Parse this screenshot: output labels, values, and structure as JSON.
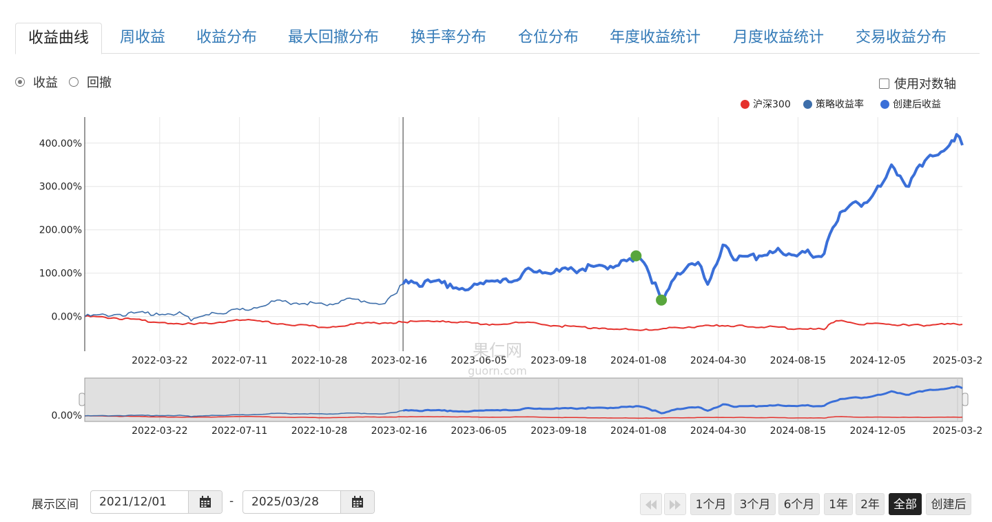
{
  "tabs": [
    "收益曲线",
    "周收益",
    "收益分布",
    "最大回撤分布",
    "换手率分布",
    "仓位分布",
    "年度收益统计",
    "月度收益统计",
    "交易收益分布"
  ],
  "active_tab": 0,
  "mode_options": [
    "收益",
    "回撤"
  ],
  "mode_selected": 0,
  "log_axis_label": "使用对数轴",
  "watermark": {
    "main": "果仁网",
    "sub": "guorn.com"
  },
  "range": {
    "label": "展示区间",
    "start": "2021/12/01",
    "end": "2025/03/28",
    "separator": "-"
  },
  "zoom_buttons": [
    "1个月",
    "3个月",
    "6个月",
    "1年",
    "2年",
    "全部",
    "创建后"
  ],
  "zoom_active": 5,
  "chart_data": {
    "type": "line",
    "ylabel": "",
    "yticks": [
      "0.00%",
      "100.00%",
      "200.00%",
      "300.00%",
      "400.00%"
    ],
    "ylim": [
      -80,
      460
    ],
    "xticks": [
      "2022-03-22",
      "2022-07-11",
      "2022-10-28",
      "2023-02-16",
      "2023-06-05",
      "2023-09-18",
      "2024-01-08",
      "2024-04-30",
      "2024-08-15",
      "2024-12-05",
      "2025-03-2"
    ],
    "navigator_ytick": "0.00%",
    "grid": true,
    "legend_position": "top-right",
    "creation_date": "2023-02-14",
    "series": [
      {
        "name": "沪深300",
        "color": "#e5322d",
        "x": [
          "2021-12-01",
          "2022-01-10",
          "2022-03-22",
          "2022-05-01",
          "2022-07-11",
          "2022-09-01",
          "2022-10-28",
          "2022-12-20",
          "2023-02-16",
          "2023-04-10",
          "2023-06-05",
          "2023-08-01",
          "2023-09-18",
          "2023-11-20",
          "2024-01-08",
          "2024-02-05",
          "2024-03-15",
          "2024-04-30",
          "2024-05-20",
          "2024-07-01",
          "2024-08-15",
          "2024-09-18",
          "2024-09-24",
          "2024-10-08",
          "2024-11-01",
          "2024-12-05",
          "2025-01-13",
          "2025-02-15",
          "2025-03-28"
        ],
        "y": [
          0,
          -3,
          -14,
          -18,
          -8,
          -17,
          -25,
          -16,
          -13,
          -10,
          -18,
          -14,
          -22,
          -27,
          -32,
          -29,
          -24,
          -21,
          -21,
          -24,
          -28,
          -30,
          -19,
          -10,
          -17,
          -16,
          -21,
          -19,
          -18
        ]
      },
      {
        "name": "策略收益率",
        "color": "#3d6eaa",
        "x": [
          "2021-12-01",
          "2022-01-15",
          "2022-03-10",
          "2022-04-15",
          "2022-04-27",
          "2022-05-30",
          "2022-07-11",
          "2022-08-20",
          "2022-10-01",
          "2022-10-28",
          "2022-12-10",
          "2023-01-20",
          "2023-02-01",
          "2023-02-14"
        ],
        "y": [
          0,
          5,
          8,
          6,
          -10,
          8,
          15,
          35,
          30,
          28,
          40,
          30,
          50,
          75
        ]
      },
      {
        "name": "创建后收益",
        "color": "#3a6fd8",
        "x": [
          "2023-02-14",
          "2023-03-01",
          "2023-04-20",
          "2023-05-15",
          "2023-06-05",
          "2023-07-10",
          "2023-08-10",
          "2023-09-18",
          "2023-10-20",
          "2023-11-20",
          "2023-12-20",
          "2024-01-02",
          "2024-01-20",
          "2024-02-06",
          "2024-02-20",
          "2024-03-15",
          "2024-04-01",
          "2024-04-10",
          "2024-05-01",
          "2024-05-20",
          "2024-06-20",
          "2024-07-20",
          "2024-08-15",
          "2024-09-18",
          "2024-09-30",
          "2024-10-10",
          "2024-10-20",
          "2024-11-20",
          "2024-12-05",
          "2024-12-20",
          "2025-01-13",
          "2025-01-28",
          "2025-02-15",
          "2025-03-10",
          "2025-03-20",
          "2025-03-28"
        ],
        "y": [
          75,
          78,
          75,
          62,
          75,
          80,
          108,
          104,
          110,
          115,
          128,
          140,
          100,
          38,
          80,
          120,
          115,
          74,
          165,
          130,
          140,
          150,
          145,
          145,
          205,
          240,
          250,
          270,
          300,
          350,
          300,
          350,
          370,
          395,
          420,
          395
        ]
      }
    ],
    "markers": [
      {
        "x": "2024-01-02",
        "y": 140,
        "color": "#58a63c"
      },
      {
        "x": "2024-02-06",
        "y": 38,
        "color": "#58a63c"
      }
    ]
  }
}
